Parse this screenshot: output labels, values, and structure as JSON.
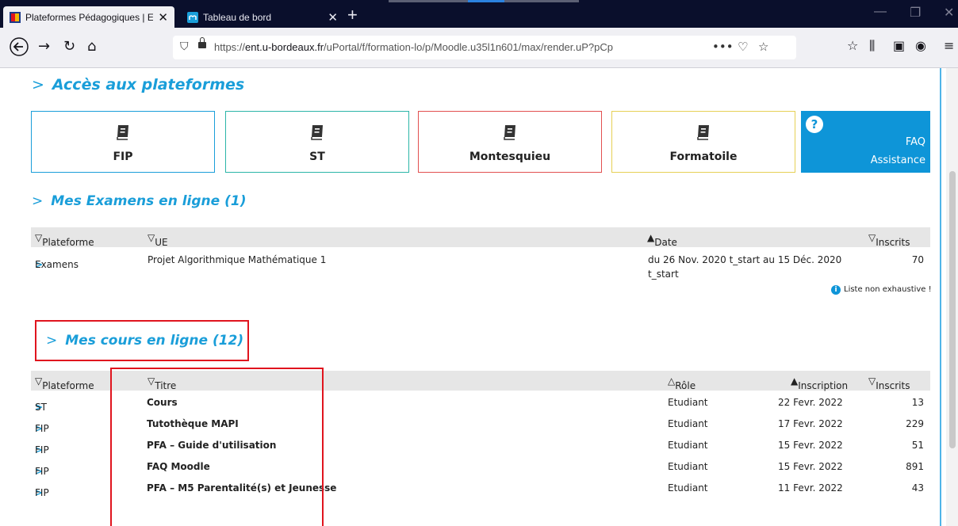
{
  "browser": {
    "tabs": [
      {
        "label": "Plateformes Pédagogiques | EN",
        "close": "✕"
      },
      {
        "label": "Tableau de bord",
        "close": "✕"
      }
    ],
    "new_tab": "+",
    "url_domain": "ent.u-bordeaux.fr",
    "url_prefix": "https://",
    "url_rest": "/uPortal/f/formation-lo/p/Moodle.u35l1n601/max/render.uP?pCp",
    "url_more": "•••"
  },
  "sections": {
    "platforms_title": "Accès aux plateformes",
    "exams_title": "Mes Examens en ligne (1)",
    "courses_title": "Mes cours en ligne (12)"
  },
  "platforms": [
    {
      "label": "FIP",
      "color": "#1a9ed9"
    },
    {
      "label": "ST",
      "color": "#2bb5a8"
    },
    {
      "label": "Montesquieu",
      "color": "#e25050"
    },
    {
      "label": "Formatoile",
      "color": "#e6d055"
    }
  ],
  "faq": {
    "line1": "FAQ",
    "line2": "Assistance",
    "icon": "?"
  },
  "exams": {
    "headers": {
      "plateforme": "Plateforme",
      "ue": "UE",
      "date": "Date",
      "inscrits": "Inscrits"
    },
    "rows": [
      {
        "plateforme": "Examens",
        "ue": "Projet Algorithmique Mathématique 1",
        "date1": "du 26 Nov. 2020 t_start au 15 Déc. 2020",
        "date2": "t_start",
        "inscrits": "70"
      }
    ],
    "note": "Liste non exhaustive !"
  },
  "courses": {
    "headers": {
      "plateforme": "Plateforme",
      "titre": "Titre",
      "role": "Rôle",
      "inscription": "Inscription",
      "inscrits": "Inscrits"
    },
    "rows": [
      {
        "plateforme": "ST",
        "titre": "Cours",
        "role": "Etudiant",
        "inscription": "22 Fevr. 2022",
        "inscrits": "13"
      },
      {
        "plateforme": "FIP",
        "titre": "Tutothèque MAPI",
        "role": "Etudiant",
        "inscription": "17 Fevr. 2022",
        "inscrits": "229"
      },
      {
        "plateforme": "FIP",
        "titre": "PFA – Guide d'utilisation",
        "role": "Etudiant",
        "inscription": "15 Fevr. 2022",
        "inscrits": "51"
      },
      {
        "plateforme": "FIP",
        "titre": "FAQ Moodle",
        "role": "Etudiant",
        "inscription": "15 Fevr. 2022",
        "inscrits": "891"
      },
      {
        "plateforme": "FIP",
        "titre": "PFA – M5 Parentalité(s) et Jeunesse",
        "role": "Etudiant",
        "inscription": "11 Fevr. 2022",
        "inscrits": "43"
      }
    ]
  }
}
